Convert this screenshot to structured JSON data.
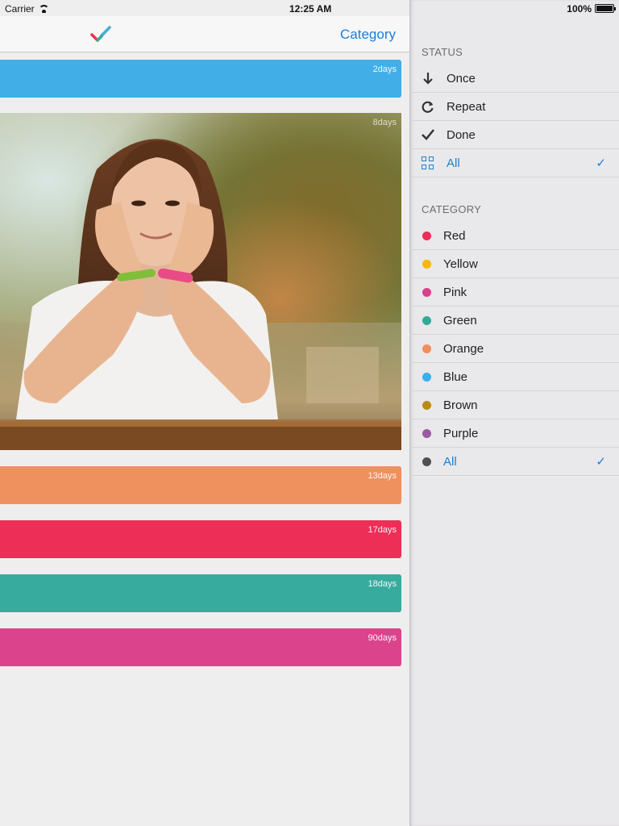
{
  "status_bar": {
    "carrier": "Carrier",
    "time": "12:25 AM",
    "battery": "100%"
  },
  "nav": {
    "category_button": "Category"
  },
  "cards": [
    {
      "days": "2days",
      "color": "#41aee8"
    },
    {
      "days": "8days",
      "color": "photo"
    },
    {
      "days": "13days",
      "color": "#ef915f"
    },
    {
      "days": "17days",
      "color": "#ed2e57"
    },
    {
      "days": "18days",
      "color": "#38ab9f"
    },
    {
      "days": "90days",
      "color": "#db448d"
    }
  ],
  "sidebar": {
    "status_header": "STATUS",
    "status_items": [
      {
        "label": "Once",
        "icon": "arrow-down-icon"
      },
      {
        "label": "Repeat",
        "icon": "repeat-icon"
      },
      {
        "label": "Done",
        "icon": "checkmark-icon"
      },
      {
        "label": "All",
        "icon": "grid-icon",
        "selected": true
      }
    ],
    "category_header": "CATEGORY",
    "category_items": [
      {
        "label": "Red",
        "color": "#ec2d57"
      },
      {
        "label": "Yellow",
        "color": "#f4b900"
      },
      {
        "label": "Pink",
        "color": "#dc3f8c"
      },
      {
        "label": "Green",
        "color": "#34a999"
      },
      {
        "label": "Orange",
        "color": "#ef8f5c"
      },
      {
        "label": "Blue",
        "color": "#3daeea"
      },
      {
        "label": "Brown",
        "color": "#b88c12"
      },
      {
        "label": "Purple",
        "color": "#9a5aa2"
      },
      {
        "label": "All",
        "color": "#505050",
        "selected": true
      }
    ],
    "selected_mark": "✓"
  }
}
